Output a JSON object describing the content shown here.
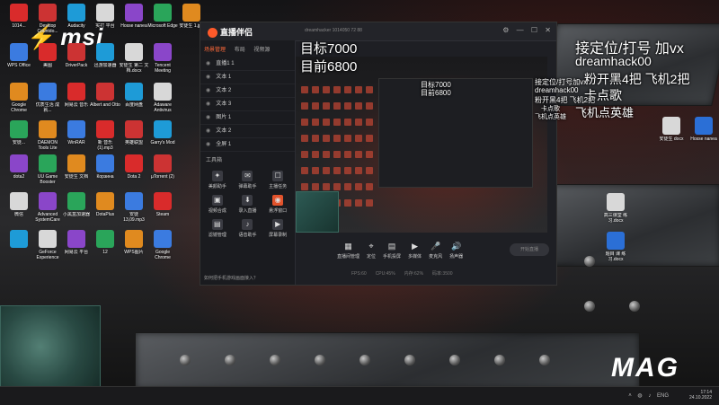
{
  "desktop": {
    "brand_left": "msi",
    "brand_right": "MAG",
    "icons": [
      {
        "name": "thispc-icon",
        "label": "1014..."
      },
      {
        "name": "wps-icon",
        "label": "WPS Office"
      },
      {
        "name": "chrome-icon",
        "label": "Google Chrome"
      },
      {
        "name": "doc-icon",
        "label": "安徒..."
      },
      {
        "name": "doc2-icon",
        "label": "dota2"
      },
      {
        "name": "wechat-icon",
        "label": "微信"
      },
      {
        "name": "game-icon",
        "label": ""
      },
      {
        "name": "desktop-icon",
        "label": "Desktop Countdo..."
      },
      {
        "name": "photo-icon",
        "label": "美图"
      },
      {
        "name": "studio-icon",
        "label": "优质生活 成就..."
      },
      {
        "name": "daemon-icon",
        "label": "DAEMON Tools Lite"
      },
      {
        "name": "ugame-icon",
        "label": "UU Game Booster"
      },
      {
        "name": "advanced-icon",
        "label": "Advanced SystemCare"
      },
      {
        "name": "geforce-icon",
        "label": "GeForce Experience"
      },
      {
        "name": "audacity-icon",
        "label": "Audacity"
      },
      {
        "name": "driverpack-icon",
        "label": "DriverPack"
      },
      {
        "name": "music-icon",
        "label": "网易云 音乐"
      },
      {
        "name": "winrar-icon",
        "label": "WinRAR"
      },
      {
        "name": "doc3-icon",
        "label": "安徒生 文档"
      },
      {
        "name": "kmplayer-icon",
        "label": "小黑盒加速器"
      },
      {
        "name": "netease-icon",
        "label": "网易云 平台"
      },
      {
        "name": "kaiji-icon",
        "label": "实打 平台"
      },
      {
        "name": "zhibo-icon",
        "label": "迅游加速器"
      },
      {
        "name": "albert-icon",
        "label": "Albert and Otto"
      },
      {
        "name": "mp3-icon",
        "label": "新 音乐 (1).mp3"
      },
      {
        "name": "korean-icon",
        "label": "Корзина"
      },
      {
        "name": "dotaplus-icon",
        "label": "DotaPlus"
      },
      {
        "name": "twelve-icon",
        "label": "12"
      },
      {
        "name": "folder-icon",
        "label": "Hosse nanea"
      },
      {
        "name": "doc4-icon",
        "label": "安徒生 第二 文档.docx"
      },
      {
        "name": "baidu-icon",
        "label": "百度网盘"
      },
      {
        "name": "steam-cn-icon",
        "label": "英雄联盟"
      },
      {
        "name": "dota2-icon",
        "label": "Dota 2"
      },
      {
        "name": "netease2-icon",
        "label": "安徒 13,09.mp3"
      },
      {
        "name": "wps2-icon",
        "label": "WPS图片"
      },
      {
        "name": "edge-icon",
        "label": "Microsoft Edge"
      },
      {
        "name": "tencent-icon",
        "label": "Tencent Meeting"
      },
      {
        "name": "adaware-icon",
        "label": "Adaware Antivirus"
      },
      {
        "name": "garrys-icon",
        "label": "Garry's Mod"
      },
      {
        "name": "utorrent-icon",
        "label": "µTorrent (2)"
      },
      {
        "name": "steam-icon",
        "label": "Steam"
      },
      {
        "name": "google-chrome-icon",
        "label": "Google Chrome"
      },
      {
        "name": "jpg-icon",
        "label": "安徒生 1.jpg"
      }
    ],
    "right_icons": [
      {
        "name": "hosse-doc-icon",
        "label": "安徒生 docx"
      },
      {
        "name": "hosse-nanea-icon",
        "label": "Hosse nanea"
      },
      {
        "name": "word-doc-icon",
        "label": "高三课堂 练习.docx"
      },
      {
        "name": "word-doc2-icon",
        "label": "题目 课 练习.docx"
      }
    ]
  },
  "overlay": {
    "target_line": "目标7000",
    "current_line": "目前6800",
    "top_right_line1": "接定位/打号 加vx",
    "top_right_line2": "dreamhack00",
    "top_right_line3": "粉开黑4把  飞机2把",
    "top_right_line4": "卡点歌",
    "top_right_line5": "飞机点英雄",
    "small_line1": "接定位/打号加vx",
    "small_line2": "dreamhack00",
    "small_line3": "粉开黑4把 飞机2把",
    "small_line4": "卡点歌",
    "small_line5": "飞机点英雄"
  },
  "app": {
    "title": "直播伴侣",
    "user_info": "dreamhacker  1014050  72  88",
    "tabs": [
      "场景管理",
      "布局",
      "视频源"
    ],
    "scenes": [
      "直播1 1",
      "文本 1",
      "文本 2",
      "文本 3",
      "图片 1",
      "文本 2",
      "全屏 1"
    ],
    "tools_label": "工具箱",
    "tools": [
      {
        "label": "美颜助手",
        "glyph": "✦",
        "hot": false
      },
      {
        "label": "弹幕助手",
        "glyph": "✉",
        "hot": false
      },
      {
        "label": "主播任务",
        "glyph": "☐",
        "hot": false
      },
      {
        "label": "视频合成",
        "glyph": "▣",
        "hot": false
      },
      {
        "label": "录入直播",
        "glyph": "⬇",
        "hot": false
      },
      {
        "label": "悬浮窗口",
        "glyph": "◉",
        "hot": true
      },
      {
        "label": "滤镜管理",
        "glyph": "▤",
        "hot": false
      },
      {
        "label": "语音助手",
        "glyph": "♪",
        "hot": false
      },
      {
        "label": "屏幕录制",
        "glyph": "▶",
        "hot": false
      }
    ],
    "help_text": "如何把手机游戏画面接入？",
    "controls": [
      {
        "label": "直播间管理",
        "glyph": "▦"
      },
      {
        "label": "定位",
        "glyph": "⌖"
      },
      {
        "label": "手机投屏",
        "glyph": "▤"
      },
      {
        "label": "多媒体",
        "glyph": "▶"
      },
      {
        "label": "麦克风",
        "glyph": "🎤"
      },
      {
        "label": "扬声器",
        "glyph": "🔊"
      }
    ],
    "start_button": "开始直播",
    "stats": [
      "FPS:60",
      "CPU:45%",
      "内存:62%",
      "码率:3500"
    ]
  },
  "taskbar": {
    "lang": "ENG",
    "time": "17:14",
    "date": "24.10.2022"
  }
}
